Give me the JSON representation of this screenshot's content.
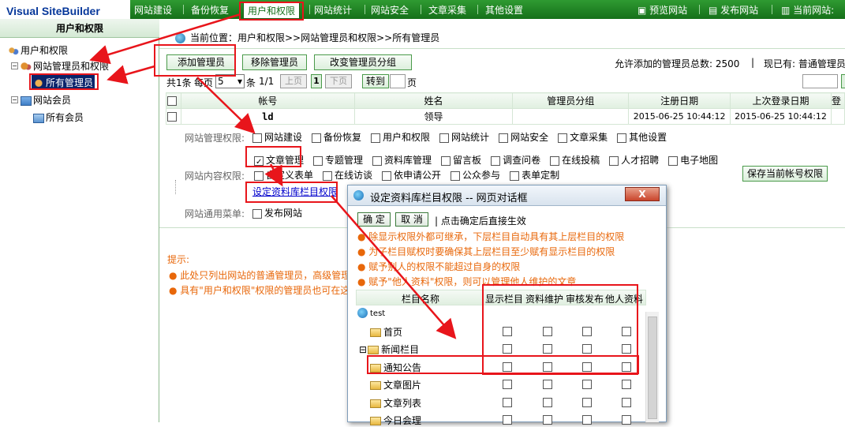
{
  "app": {
    "logo_text": "Visual SiteBuilder"
  },
  "topnav": {
    "items": [
      "网站建设",
      "备份恢复",
      "用户和权限",
      "网站统计",
      "网站安全",
      "文章采集",
      "其他设置"
    ],
    "right": [
      "预览网站",
      "发布网站",
      "当前网站:"
    ]
  },
  "sidebar": {
    "title": "用户和权限",
    "tree": [
      "用户和权限",
      "网站管理员和权限",
      "所有管理员",
      "网站会员",
      "所有会员"
    ]
  },
  "main": {
    "breadcrumb": "当前位置：用户和权限>>网站管理员和权限>>所有管理员",
    "buttons": {
      "add": "添加管理员",
      "remove": "移除管理员",
      "change_group": "改变管理员分组"
    },
    "allowed_text": "允许添加的管理员总数: 2500",
    "current_text": "现已有: 普通管理员",
    "pager": {
      "total": "共1条",
      "per_page_label": "每页",
      "per_page_value": "5",
      "unit": "条",
      "page_info": "1/1",
      "prev": "上页",
      "current": "1",
      "next": "下页",
      "goto": "转到",
      "page_label": "页"
    },
    "table": {
      "headers": [
        "帐号",
        "姓名",
        "管理员分组",
        "注册日期",
        "上次登录日期",
        "登"
      ],
      "rows": [
        {
          "account": "ld",
          "name": "领导",
          "group": "",
          "reg_date": "2015-06-25 10:44:12",
          "last_login": "2015-06-25 10:44:12"
        }
      ]
    },
    "perm_site_label": "网站管理权限:",
    "perm_site_items": [
      "网站建设",
      "备份恢复",
      "用户和权限",
      "网站统计",
      "网站安全",
      "文章采集",
      "其他设置"
    ],
    "perm_content_label": "网站内容权限:",
    "perm_content_row1": [
      "文章管理",
      "专题管理",
      "资料库管理",
      "留言板",
      "调查问卷",
      "在线投稿",
      "人才招聘",
      "电子地图"
    ],
    "perm_content_row2": [
      "自定义表单",
      "在线访谈",
      "依申请公开",
      "公众参与",
      "表单定制"
    ],
    "save_button": "保存当前帐号权限",
    "set_column_link": "设定资料库栏目权限",
    "common_menu_label": "网站通用菜单:",
    "common_menu_items": [
      "发布网站"
    ],
    "tips_title": "提示:",
    "tips": [
      "此处只列出网站的普通管理员，高级管理",
      "具有\"用户和权限\"权限的管理员也可在这"
    ]
  },
  "dialog": {
    "title": "设定资料库栏目权限 -- 网页对话框",
    "close": "X",
    "ok": "确 定",
    "cancel": "取 消",
    "hint": "点击确定后直接生效",
    "notes": [
      "除显示权限外都可继承，下层栏目自动具有其上层栏目的权限",
      "为子栏目赋权时要确保其上层栏目至少赋有显示栏目的权限",
      "赋予别人的权限不能超过自身的权限",
      "赋予\"他人资料\"权限，则可以管理他人维护的文章"
    ],
    "columns": [
      "栏目名称",
      "显示栏目",
      "资料维护",
      "审核发布",
      "他人资料"
    ],
    "rows": [
      "test",
      "首页",
      "新闻栏目",
      "通知公告",
      "文章图片",
      "文章列表",
      "今日会理"
    ]
  },
  "colors": {
    "nav_green": "#15701a",
    "highlight_red": "#e8151b",
    "note_orange": "#e8670a"
  }
}
